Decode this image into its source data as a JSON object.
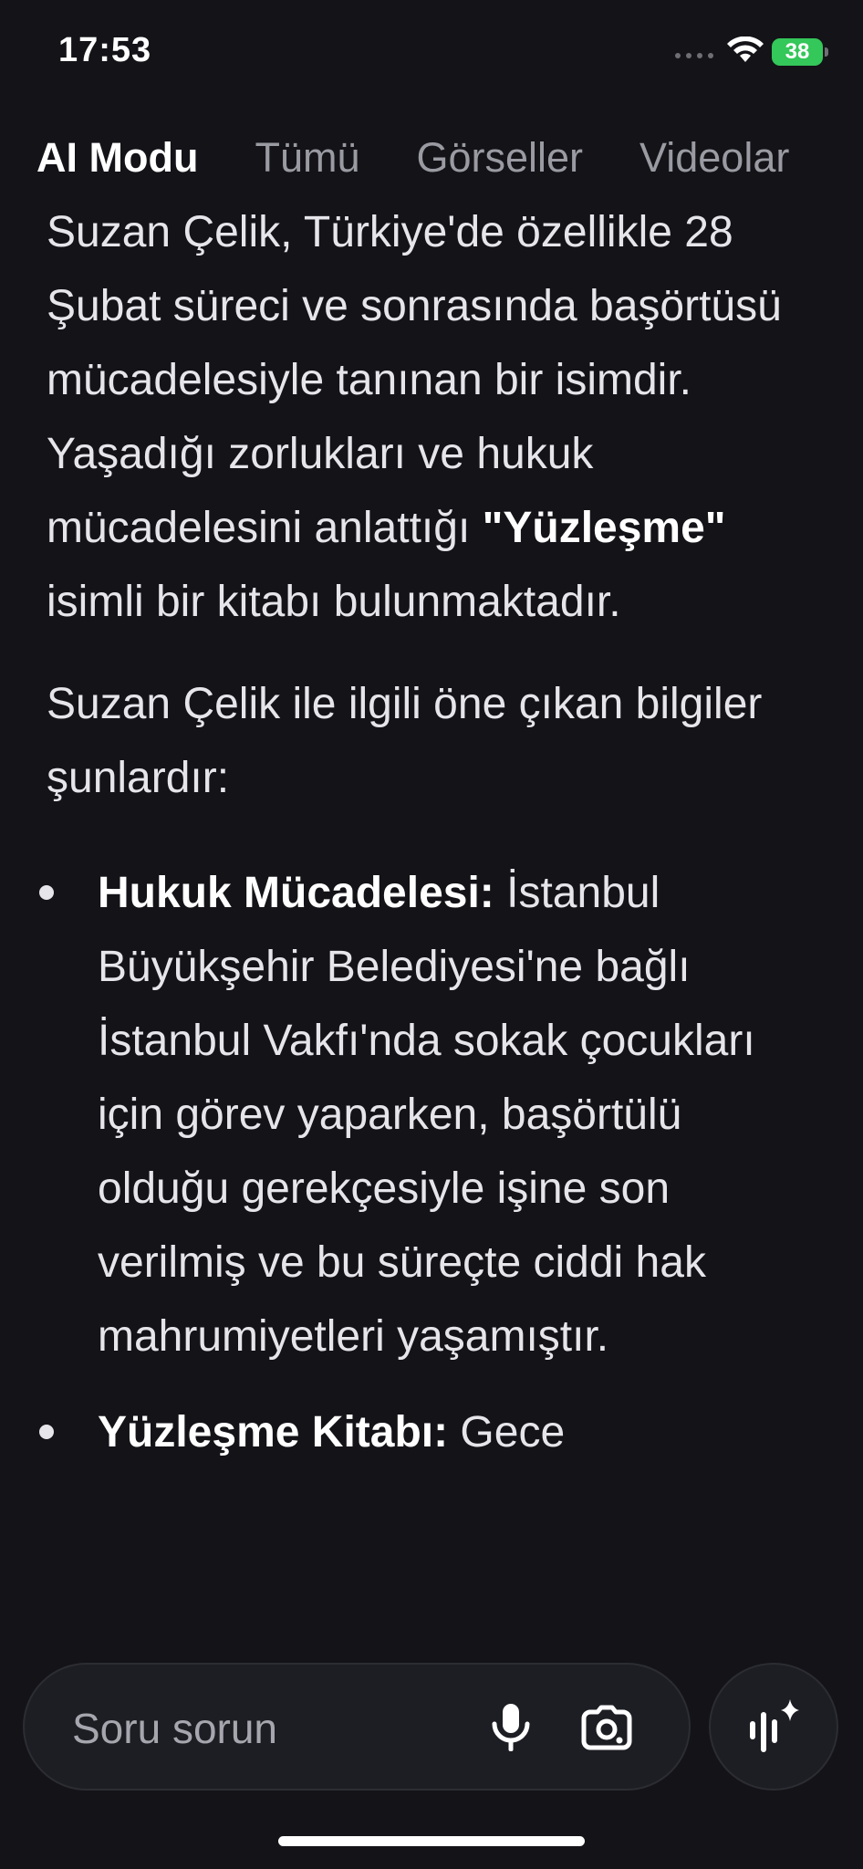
{
  "status_bar": {
    "time": "17:53",
    "battery": "38"
  },
  "tabs": [
    {
      "label": "AI Modu",
      "active": true
    },
    {
      "label": "Tümü",
      "active": false
    },
    {
      "label": "Görseller",
      "active": false
    },
    {
      "label": "Videolar",
      "active": false
    }
  ],
  "content": {
    "intro_text": "Suzan Çelik, Türkiye'de özellikle 28 Şubat süreci ve sonrasında başörtüsü mücadelesiyle tanınan bir isimdir. Yaşadığı zorlukları ve hukuk mücadelesini anlattığı ",
    "intro_bold": "\"Yüzleşme\"",
    "intro_tail": " isimli bir kitabı bulunmaktadır.",
    "summary_text": "Suzan Çelik ile ilgili öne çıkan bilgiler şunlardır:",
    "bullets": [
      {
        "title": "Hukuk Mücadelesi:",
        "text": " İstanbul Büyükşehir Belediyesi'ne bağlı İstanbul Vakfı'nda sokak çocukları için görev yaparken, başörtülü olduğu gerekçesiyle işine son verilmiş ve bu süreçte ciddi hak mahrumiyetleri yaşamıştır."
      },
      {
        "title": "Yüzleşme Kitabı:",
        "text": " Gece"
      }
    ]
  },
  "ask_bar": {
    "placeholder": "Soru sorun"
  },
  "icons": {
    "mic": "microphone-icon",
    "lens": "google-lens-icon",
    "ai_mode": "ai-mode-sparkle-icon"
  },
  "colors": {
    "background": "#131318",
    "text": "#e6e6ea",
    "muted": "#9a9aa2",
    "battery": "#34c759"
  }
}
